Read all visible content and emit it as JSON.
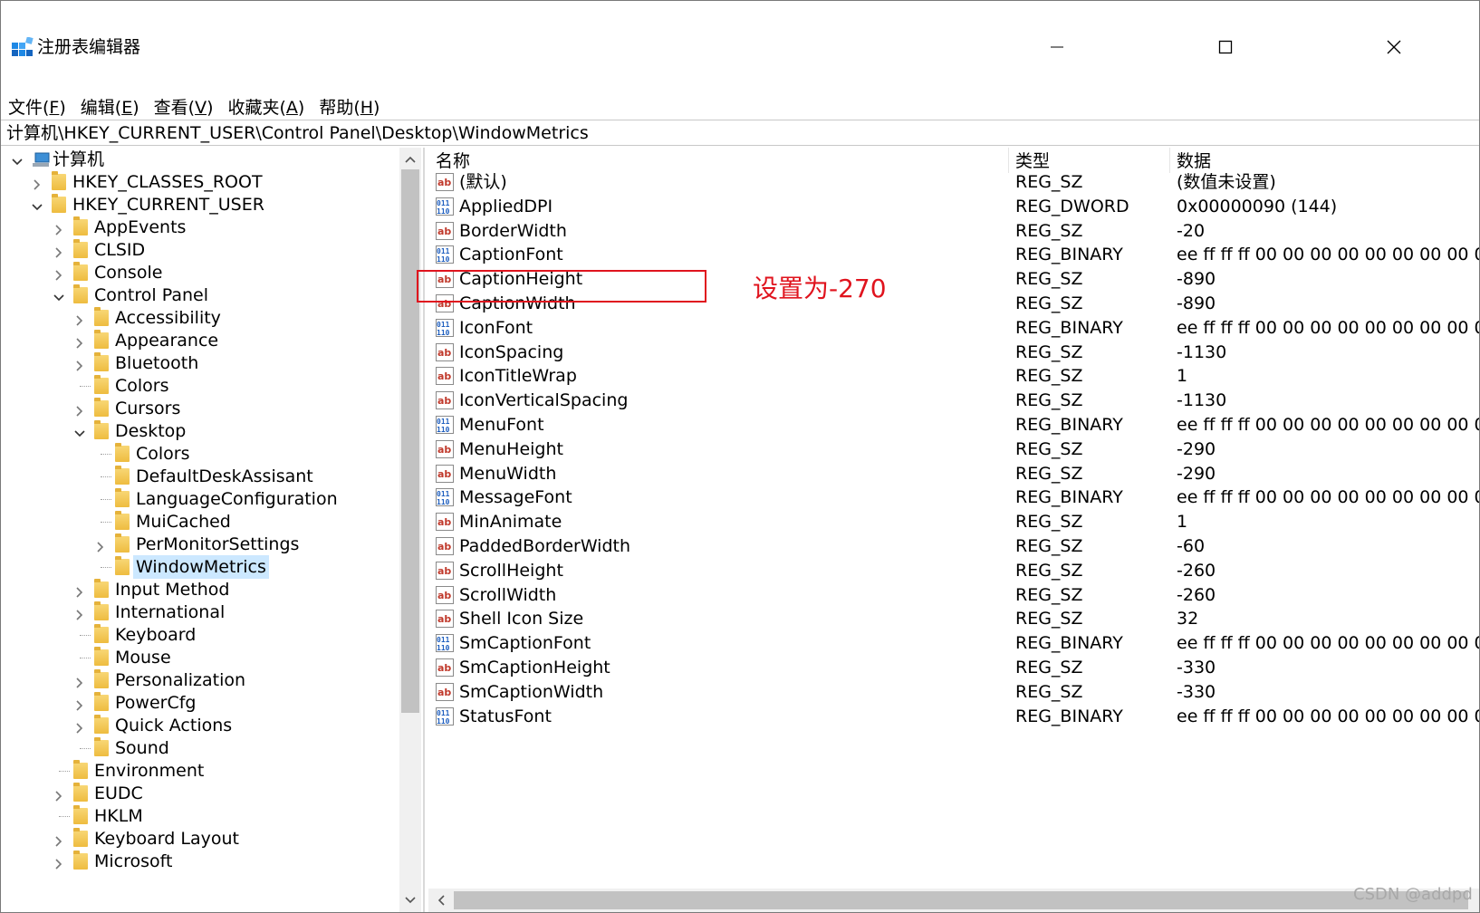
{
  "window": {
    "title": "注册表编辑器"
  },
  "menu": [
    {
      "label": "文件(",
      "key": "F",
      "end": ")"
    },
    {
      "label": "编辑(",
      "key": "E",
      "end": ")"
    },
    {
      "label": "查看(",
      "key": "V",
      "end": ")"
    },
    {
      "label": "收藏夹(",
      "key": "A",
      "end": ")"
    },
    {
      "label": "帮助(",
      "key": "H",
      "end": ")"
    }
  ],
  "address": "计算机\\HKEY_CURRENT_USER\\Control Panel\\Desktop\\WindowMetrics",
  "tree": {
    "root": "计算机",
    "items": [
      {
        "label": "HKEY_CLASSES_ROOT",
        "level": 1,
        "chevron": "right"
      },
      {
        "label": "HKEY_CURRENT_USER",
        "level": 1,
        "chevron": "down"
      },
      {
        "label": "AppEvents",
        "level": 2,
        "chevron": "right"
      },
      {
        "label": "CLSID",
        "level": 2,
        "chevron": "right"
      },
      {
        "label": "Console",
        "level": 2,
        "chevron": "right"
      },
      {
        "label": "Control Panel",
        "level": 2,
        "chevron": "down"
      },
      {
        "label": "Accessibility",
        "level": 3,
        "chevron": "right"
      },
      {
        "label": "Appearance",
        "level": 3,
        "chevron": "right"
      },
      {
        "label": "Bluetooth",
        "level": 3,
        "chevron": "right"
      },
      {
        "label": "Colors",
        "level": 3,
        "chevron": "none"
      },
      {
        "label": "Cursors",
        "level": 3,
        "chevron": "right"
      },
      {
        "label": "Desktop",
        "level": 3,
        "chevron": "down"
      },
      {
        "label": "Colors",
        "level": 4,
        "chevron": "none"
      },
      {
        "label": "DefaultDeskAssisant",
        "level": 4,
        "chevron": "none"
      },
      {
        "label": "LanguageConfiguration",
        "level": 4,
        "chevron": "none"
      },
      {
        "label": "MuiCached",
        "level": 4,
        "chevron": "none"
      },
      {
        "label": "PerMonitorSettings",
        "level": 4,
        "chevron": "right"
      },
      {
        "label": "WindowMetrics",
        "level": 4,
        "chevron": "none",
        "selected": true
      },
      {
        "label": "Input Method",
        "level": 3,
        "chevron": "right"
      },
      {
        "label": "International",
        "level": 3,
        "chevron": "right"
      },
      {
        "label": "Keyboard",
        "level": 3,
        "chevron": "none"
      },
      {
        "label": "Mouse",
        "level": 3,
        "chevron": "none"
      },
      {
        "label": "Personalization",
        "level": 3,
        "chevron": "right"
      },
      {
        "label": "PowerCfg",
        "level": 3,
        "chevron": "right"
      },
      {
        "label": "Quick Actions",
        "level": 3,
        "chevron": "right"
      },
      {
        "label": "Sound",
        "level": 3,
        "chevron": "none"
      },
      {
        "label": "Environment",
        "level": 2,
        "chevron": "none"
      },
      {
        "label": "EUDC",
        "level": 2,
        "chevron": "right"
      },
      {
        "label": "HKLM",
        "level": 2,
        "chevron": "none"
      },
      {
        "label": "Keyboard Layout",
        "level": 2,
        "chevron": "right"
      },
      {
        "label": "Microsoft",
        "level": 2,
        "chevron": "right"
      }
    ]
  },
  "list": {
    "columns": {
      "name": "名称",
      "type": "类型",
      "data": "数据"
    },
    "rows": [
      {
        "icon": "string-value-icon",
        "name": "(默认)",
        "type": "REG_SZ",
        "data": "(数值未设置)"
      },
      {
        "icon": "binary-value-icon",
        "name": "AppliedDPI",
        "type": "REG_DWORD",
        "data": "0x00000090 (144)"
      },
      {
        "icon": "string-value-icon",
        "name": "BorderWidth",
        "type": "REG_SZ",
        "data": "-20"
      },
      {
        "icon": "binary-value-icon",
        "name": "CaptionFont",
        "type": "REG_BINARY",
        "data": "ee ff ff ff 00 00 00 00 00 00 00 00 00 0"
      },
      {
        "icon": "string-value-icon",
        "name": "CaptionHeight",
        "type": "REG_SZ",
        "data": "-890"
      },
      {
        "icon": "string-value-icon",
        "name": "CaptionWidth",
        "type": "REG_SZ",
        "data": "-890"
      },
      {
        "icon": "binary-value-icon",
        "name": "IconFont",
        "type": "REG_BINARY",
        "data": "ee ff ff ff 00 00 00 00 00 00 00 00 00 0"
      },
      {
        "icon": "string-value-icon",
        "name": "IconSpacing",
        "type": "REG_SZ",
        "data": "-1130"
      },
      {
        "icon": "string-value-icon",
        "name": "IconTitleWrap",
        "type": "REG_SZ",
        "data": "1"
      },
      {
        "icon": "string-value-icon",
        "name": "IconVerticalSpacing",
        "type": "REG_SZ",
        "data": "-1130"
      },
      {
        "icon": "binary-value-icon",
        "name": "MenuFont",
        "type": "REG_BINARY",
        "data": "ee ff ff ff 00 00 00 00 00 00 00 00 00 0"
      },
      {
        "icon": "string-value-icon",
        "name": "MenuHeight",
        "type": "REG_SZ",
        "data": "-290"
      },
      {
        "icon": "string-value-icon",
        "name": "MenuWidth",
        "type": "REG_SZ",
        "data": "-290"
      },
      {
        "icon": "binary-value-icon",
        "name": "MessageFont",
        "type": "REG_BINARY",
        "data": "ee ff ff ff 00 00 00 00 00 00 00 00 00 0"
      },
      {
        "icon": "string-value-icon",
        "name": "MinAnimate",
        "type": "REG_SZ",
        "data": "1"
      },
      {
        "icon": "string-value-icon",
        "name": "PaddedBorderWidth",
        "type": "REG_SZ",
        "data": "-60"
      },
      {
        "icon": "string-value-icon",
        "name": "ScrollHeight",
        "type": "REG_SZ",
        "data": "-260"
      },
      {
        "icon": "string-value-icon",
        "name": "ScrollWidth",
        "type": "REG_SZ",
        "data": "-260"
      },
      {
        "icon": "string-value-icon",
        "name": "Shell Icon Size",
        "type": "REG_SZ",
        "data": "32"
      },
      {
        "icon": "binary-value-icon",
        "name": "SmCaptionFont",
        "type": "REG_BINARY",
        "data": "ee ff ff ff 00 00 00 00 00 00 00 00 00 0"
      },
      {
        "icon": "string-value-icon",
        "name": "SmCaptionHeight",
        "type": "REG_SZ",
        "data": "-330"
      },
      {
        "icon": "string-value-icon",
        "name": "SmCaptionWidth",
        "type": "REG_SZ",
        "data": "-330"
      },
      {
        "icon": "binary-value-icon",
        "name": "StatusFont",
        "type": "REG_BINARY",
        "data": "ee ff ff ff 00 00 00 00 00 00 00 00 00 0"
      }
    ]
  },
  "annotation": {
    "text": "设置为-270",
    "color": "#e0141e"
  },
  "watermark": "CSDN @addpd",
  "colors": {
    "selection": "#cce8ff",
    "folder": "#f8d775",
    "string_icon": "#c0392b",
    "binary_icon": "#1f5fbf"
  }
}
